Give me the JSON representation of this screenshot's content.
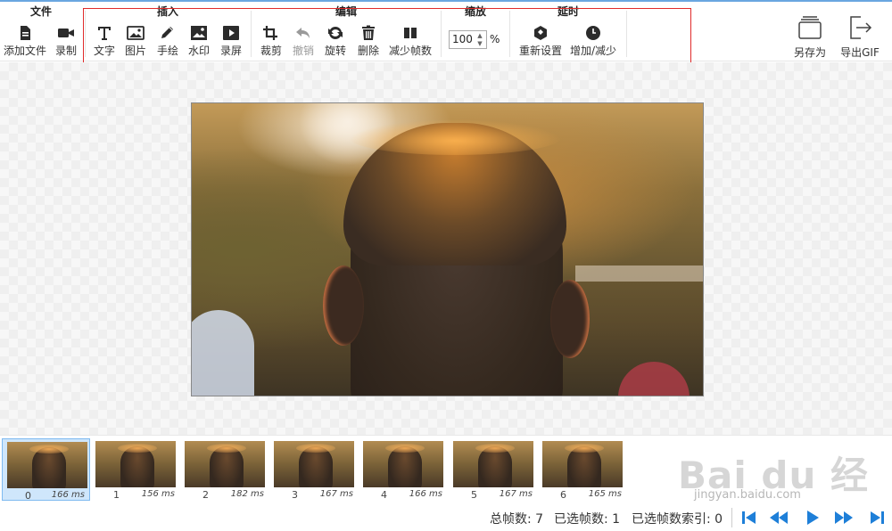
{
  "toolbar": {
    "groups": {
      "file": "文件",
      "insert": "插入",
      "edit": "编辑",
      "zoom": "缩放",
      "delay": "延时"
    },
    "file": {
      "add_file": "添加文件",
      "record": "录制"
    },
    "insert": {
      "text": "文字",
      "image": "图片",
      "draw": "手绘",
      "watermark": "水印",
      "screen_record": "录屏"
    },
    "edit": {
      "crop": "裁剪",
      "undo": "撤销",
      "rotate": "旋转",
      "delete": "删除",
      "reduce_frames": "减少帧数"
    },
    "zoom": {
      "value": "100",
      "unit": "%"
    },
    "delay": {
      "reset": "重新设置",
      "adjust": "增加/减少"
    },
    "save_as": "另存为",
    "export_gif": "导出GIF",
    "accent_color": "#1e7fd8",
    "highlight_color": "#e02a2a"
  },
  "icons": {
    "add_file": "document-icon",
    "record": "video-camera-icon",
    "text": "text-t-icon",
    "image": "image-icon",
    "draw": "pencil-icon",
    "watermark": "watermark-image-icon",
    "screen_record": "play-frame-icon",
    "crop": "crop-icon",
    "undo": "undo-icon",
    "rotate": "rotate-icon",
    "delete": "trash-icon",
    "reduce_frames": "reduce-frames-icon",
    "reset": "hexagon-icon",
    "adjust": "clock-icon",
    "save_as": "stack-icon",
    "export": "exit-icon"
  },
  "frames": [
    {
      "index": "0",
      "duration": "166 ms",
      "selected": true
    },
    {
      "index": "1",
      "duration": "156 ms",
      "selected": false
    },
    {
      "index": "2",
      "duration": "182 ms",
      "selected": false
    },
    {
      "index": "3",
      "duration": "167 ms",
      "selected": false
    },
    {
      "index": "4",
      "duration": "166 ms",
      "selected": false
    },
    {
      "index": "5",
      "duration": "167 ms",
      "selected": false
    },
    {
      "index": "6",
      "duration": "165 ms",
      "selected": false
    }
  ],
  "status": {
    "total_frames": "总帧数: 7",
    "selected_frames": "已选帧数: 1",
    "selected_index": "已选帧数索引: 0"
  },
  "watermark": {
    "logo": "Bai du 经验",
    "url": "jingyan.baidu.com"
  }
}
